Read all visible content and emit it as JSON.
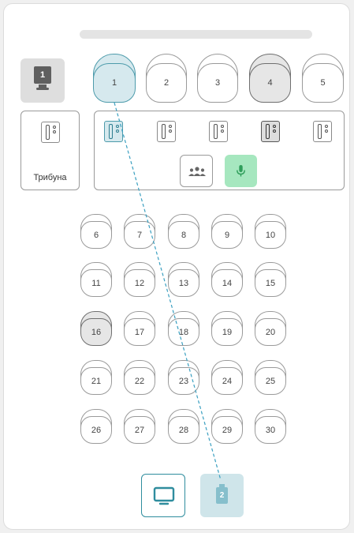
{
  "screen": {
    "number": "1"
  },
  "tribune": {
    "label": "Трибуна"
  },
  "top_seats": [
    {
      "label": "1",
      "state": "active"
    },
    {
      "label": "2",
      "state": "normal"
    },
    {
      "label": "3",
      "state": "normal"
    },
    {
      "label": "4",
      "state": "gray"
    },
    {
      "label": "5",
      "state": "normal"
    }
  ],
  "microphones": [
    {
      "state": "active"
    },
    {
      "state": "normal"
    },
    {
      "state": "normal"
    },
    {
      "state": "gray"
    },
    {
      "state": "normal"
    }
  ],
  "grid_seats": [
    {
      "label": "6",
      "state": "normal"
    },
    {
      "label": "7",
      "state": "normal"
    },
    {
      "label": "8",
      "state": "normal"
    },
    {
      "label": "9",
      "state": "normal"
    },
    {
      "label": "10",
      "state": "normal"
    },
    {
      "label": "11",
      "state": "normal"
    },
    {
      "label": "12",
      "state": "normal"
    },
    {
      "label": "13",
      "state": "normal"
    },
    {
      "label": "14",
      "state": "normal"
    },
    {
      "label": "15",
      "state": "normal"
    },
    {
      "label": "16",
      "state": "gray"
    },
    {
      "label": "17",
      "state": "normal"
    },
    {
      "label": "18",
      "state": "normal"
    },
    {
      "label": "19",
      "state": "normal"
    },
    {
      "label": "20",
      "state": "normal"
    },
    {
      "label": "21",
      "state": "normal"
    },
    {
      "label": "22",
      "state": "normal"
    },
    {
      "label": "23",
      "state": "normal"
    },
    {
      "label": "24",
      "state": "normal"
    },
    {
      "label": "25",
      "state": "normal"
    },
    {
      "label": "26",
      "state": "normal"
    },
    {
      "label": "27",
      "state": "normal"
    },
    {
      "label": "28",
      "state": "normal"
    },
    {
      "label": "29",
      "state": "normal"
    },
    {
      "label": "30",
      "state": "normal"
    }
  ],
  "bottom": {
    "device_number": "2"
  },
  "icons": {
    "group": "group-icon",
    "voice": "microphone-icon",
    "monitor": "monitor-icon",
    "device": "device-icon"
  },
  "colors": {
    "accent": "#2f8d9e",
    "active_fill": "#d6e9ee",
    "green": "#a6e7bf",
    "gray_fill": "#e6e6e6",
    "link_line": "#3a9fc0"
  }
}
